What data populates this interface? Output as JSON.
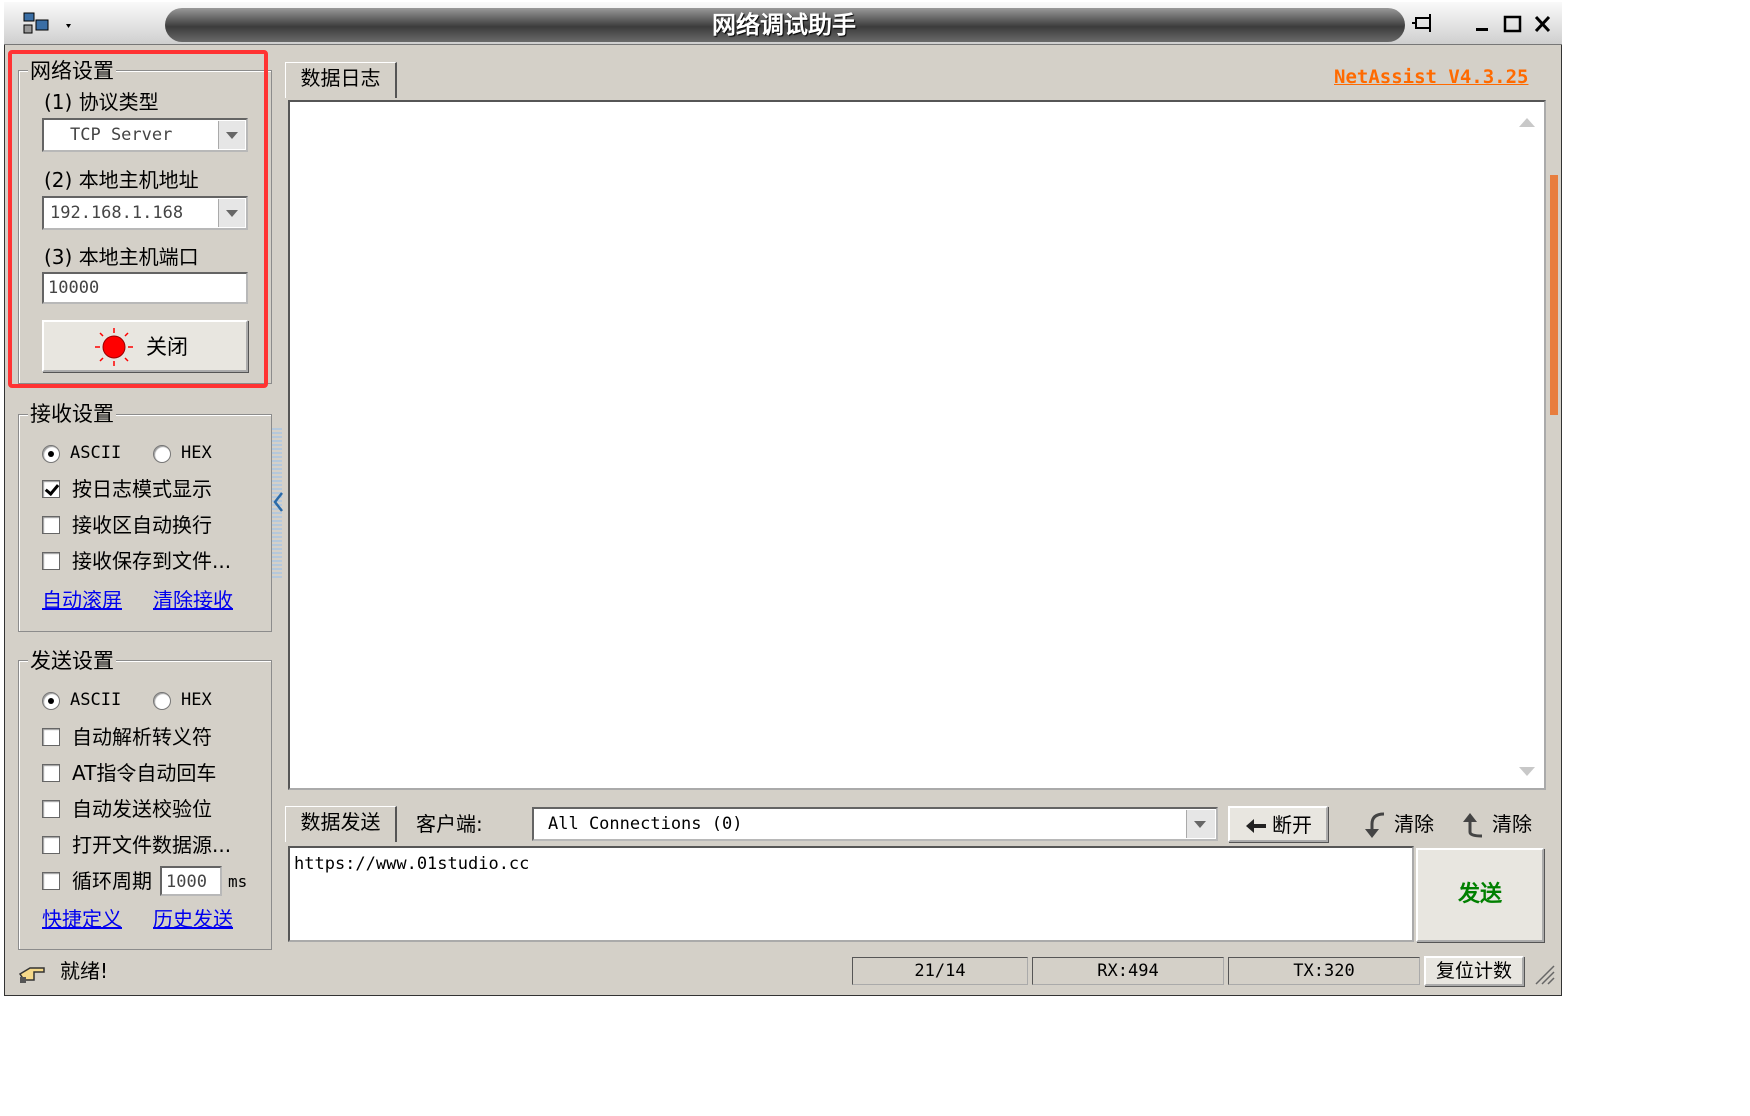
{
  "window": {
    "title": "网络调试助手"
  },
  "network": {
    "legend": "网络设置",
    "protocol_label": "(1) 协议类型",
    "protocol_value": "TCP Server",
    "host_label": "(2) 本地主机地址",
    "host_value": "192.168.1.168",
    "port_label": "(3) 本地主机端口",
    "port_value": "10000",
    "toggle_label": "关闭"
  },
  "receive": {
    "legend": "接收设置",
    "ascii": "ASCII",
    "hex": "HEX",
    "log_mode": "按日志模式显示",
    "auto_wrap": "接收区自动换行",
    "save_file": "接收保存到文件...",
    "auto_scroll": "自动滚屏",
    "clear_recv": "清除接收"
  },
  "send": {
    "legend": "发送设置",
    "ascii": "ASCII",
    "hex": "HEX",
    "escape": "自动解析转义符",
    "at_cr": "AT指令自动回车",
    "checksum": "自动发送校验位",
    "file_src": "打开文件数据源...",
    "cycle": "循环周期",
    "cycle_value": "1000",
    "cycle_unit": "ms",
    "shortcut": "快捷定义",
    "history": "历史发送"
  },
  "log": {
    "tab": "数据日志",
    "version": "NetAssist V4.3.25"
  },
  "sendbar": {
    "tab": "数据发送",
    "client_label": "客户端:",
    "client_value": "All Connections (0)",
    "disconnect": "断开",
    "clear1": "清除",
    "clear2": "清除",
    "input_text": "https://www.01studio.cc",
    "send_button": "发送"
  },
  "status": {
    "text": "就绪!",
    "ratio": "21/14",
    "rx": "RX:494",
    "tx": "TX:320",
    "reset": "复位计数"
  },
  "colors": {
    "highlight": "#ff3333",
    "version": "#ff6a00",
    "send": "#008000",
    "led": "#ff0000"
  }
}
